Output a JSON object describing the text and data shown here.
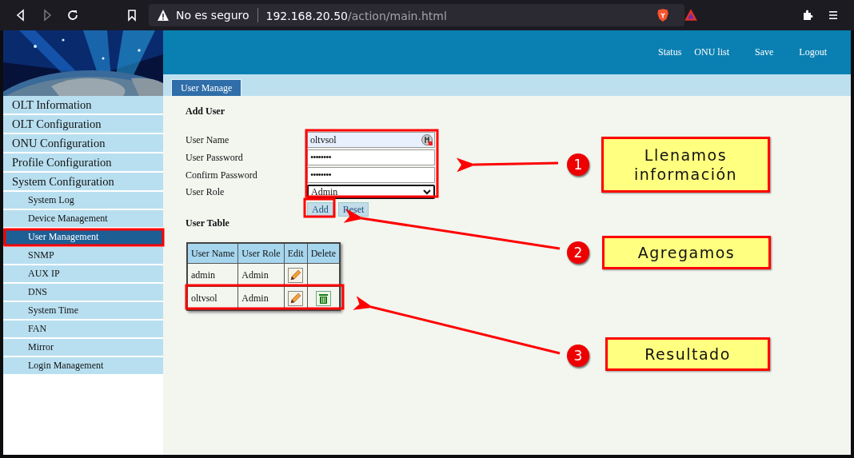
{
  "browser": {
    "security_label": "No es seguro",
    "url_host": "192.168.20.50",
    "url_path": "/action/main.html"
  },
  "header": {
    "nav": [
      "Status",
      "ONU list",
      "Save",
      "Logout"
    ]
  },
  "sidebar": {
    "items": [
      {
        "label": "OLT Information",
        "selected": false
      },
      {
        "label": "OLT Configuration",
        "selected": false
      },
      {
        "label": "ONU Configuration",
        "selected": false
      },
      {
        "label": "Profile Configuration",
        "selected": false
      },
      {
        "label": "System Configuration",
        "selected": false,
        "children": [
          {
            "label": "System Log",
            "selected": false
          },
          {
            "label": "Device Management",
            "selected": false
          },
          {
            "label": "User Management",
            "selected": true
          },
          {
            "label": "SNMP",
            "selected": false
          },
          {
            "label": "AUX IP",
            "selected": false
          },
          {
            "label": "DNS",
            "selected": false
          },
          {
            "label": "System Time",
            "selected": false
          },
          {
            "label": "FAN",
            "selected": false
          },
          {
            "label": "Mirror",
            "selected": false
          },
          {
            "label": "Login Management",
            "selected": false
          }
        ]
      }
    ]
  },
  "tabs": [
    {
      "label": "User Manage",
      "selected": true
    }
  ],
  "add_user": {
    "title": "Add User",
    "fields": [
      {
        "kind": "text",
        "label": "User Name",
        "value": "oltvsol"
      },
      {
        "kind": "password",
        "label": "User Password",
        "value": "••••••••"
      },
      {
        "kind": "password",
        "label": "Confirm Password",
        "value": "••••••••"
      },
      {
        "kind": "select",
        "label": "User Role",
        "value": "Admin"
      }
    ],
    "buttons": [
      "Add",
      "Reset"
    ]
  },
  "user_table": {
    "title": "User Table",
    "columns": [
      "User Name",
      "User Role",
      "Edit",
      "Delete"
    ],
    "rows": [
      {
        "user_name": "admin",
        "user_role": "Admin",
        "deletable": false
      },
      {
        "user_name": "oltvsol",
        "user_role": "Admin",
        "deletable": true
      }
    ]
  },
  "annotations": [
    {
      "number": "1",
      "text": "Llenamos información"
    },
    {
      "number": "2",
      "text": "Agregamos"
    },
    {
      "number": "3",
      "text": "Resultado"
    }
  ]
}
